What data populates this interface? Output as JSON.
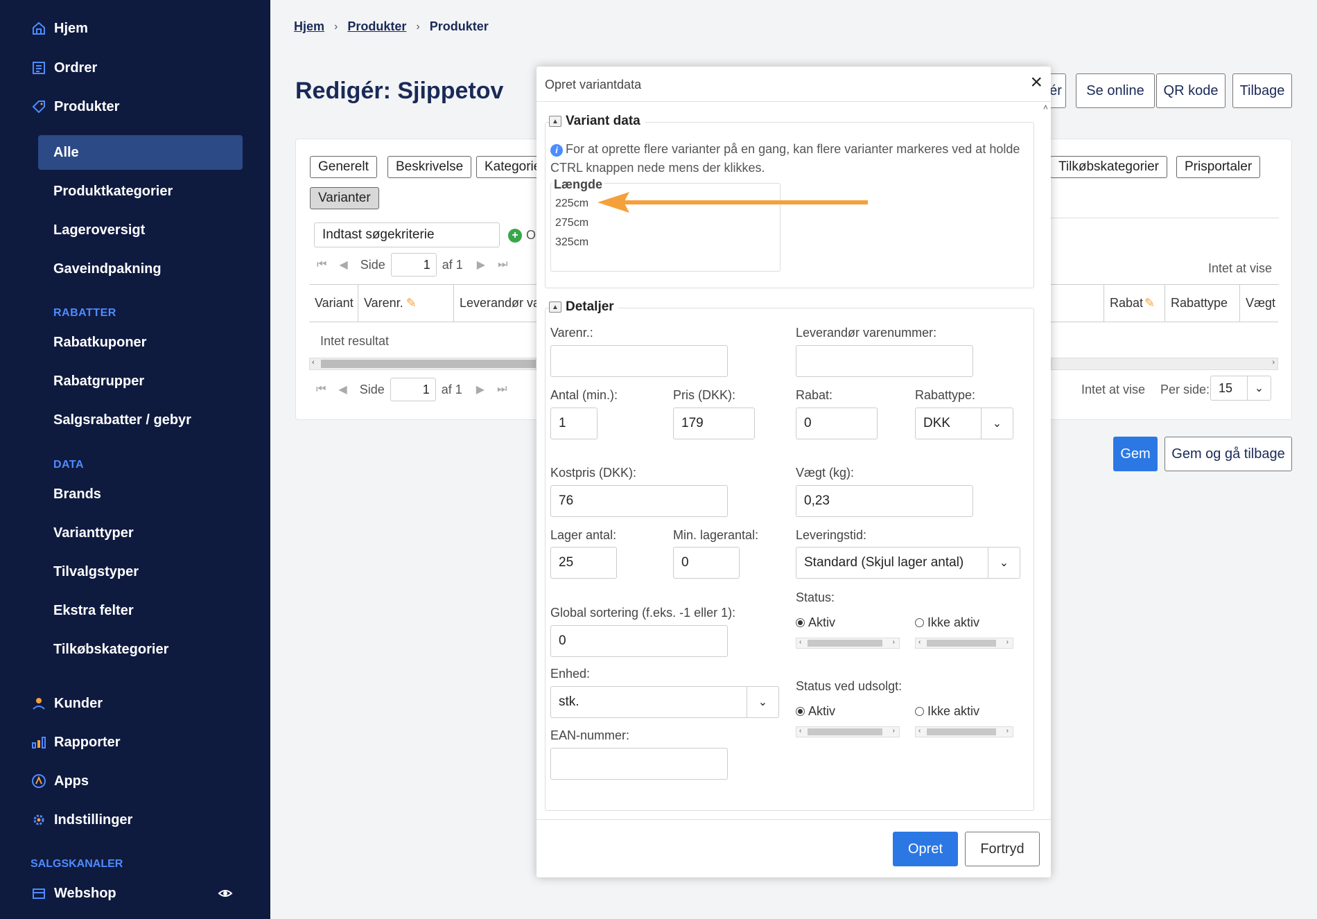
{
  "sidebar": {
    "items": [
      {
        "label": "Hjem",
        "icon": "home-icon"
      },
      {
        "label": "Ordrer",
        "icon": "orders-icon"
      },
      {
        "label": "Produkter",
        "icon": "tag-icon"
      }
    ],
    "sub_items": [
      "Alle",
      "Produktkategorier",
      "Lageroversigt",
      "Gaveindpakning"
    ],
    "rabatter_head": "RABATTER",
    "rabatter_items": [
      "Rabatkuponer",
      "Rabatgrupper",
      "Salgsrabatter / gebyr"
    ],
    "data_head": "DATA",
    "data_items": [
      "Brands",
      "Varianttyper",
      "Tilvalgstyper",
      "Ekstra felter",
      "Tilkøbskategorier"
    ],
    "bottom_items": [
      {
        "label": "Kunder",
        "icon": "user-icon"
      },
      {
        "label": "Rapporter",
        "icon": "bar-chart-icon"
      },
      {
        "label": "Apps",
        "icon": "apps-icon"
      },
      {
        "label": "Indstillinger",
        "icon": "gear-icon"
      }
    ],
    "salgskanaler_head": "SALGSKANALER",
    "webshop": "Webshop",
    "accent": "#4d8cff",
    "background": "#0f1a3f"
  },
  "breadcrumb": {
    "items": [
      "Hjem",
      "Produkter"
    ],
    "current": "Produkter"
  },
  "page": {
    "title": "Redigér: Sjippetov",
    "top_buttons": [
      "ér",
      "Se online",
      "QR kode",
      "Tilbage"
    ],
    "tabs": [
      "Generelt",
      "Beskrivelse",
      "Kategorie",
      "Tilkøbskategorier",
      "Prisportaler",
      "Varianter"
    ],
    "search_placeholder": "Indtast søgekriterie",
    "add_label": "O",
    "pager": {
      "side": "Side",
      "page": "1",
      "of": "af 1"
    },
    "nothing_to_show": "Intet at vise",
    "per_side": "Per side:",
    "per_side_value": "15",
    "columns_left": [
      "Variant",
      "Varenr.",
      "Leverandør va"
    ],
    "columns_right": [
      "Rabat",
      "Rabattype",
      "Vægt"
    ],
    "no_result": "Intet resultat",
    "save": "Gem",
    "save_back": "Gem og gå tilbage"
  },
  "modal": {
    "title": "Opret variantdata",
    "variant_data": {
      "legend": "Variant data",
      "info": "For at oprette flere varianter på en gang, kan flere varianter markeres ved at holde CTRL knappen nede mens der klikkes.",
      "list_title": "Længde",
      "options": [
        "225cm",
        "275cm",
        "325cm"
      ]
    },
    "details": {
      "legend": "Detaljer",
      "varenr_label": "Varenr.:",
      "varenr_value": "",
      "lev_label": "Leverandør varenummer:",
      "lev_value": "",
      "antal_label": "Antal (min.):",
      "antal_value": "1",
      "pris_label": "Pris (DKK):",
      "pris_value": "179",
      "rabat_label": "Rabat:",
      "rabat_value": "0",
      "rabattype_label": "Rabattype:",
      "rabattype_value": "DKK",
      "kostpris_label": "Kostpris (DKK):",
      "kostpris_value": "76",
      "vaegt_label": "Vægt (kg):",
      "vaegt_value": "0,23",
      "lager_label": "Lager antal:",
      "lager_value": "25",
      "minlager_label": "Min. lagerantal:",
      "minlager_value": "0",
      "levtid_label": "Leveringstid:",
      "levtid_value": "Standard (Skjul lager antal)",
      "sort_label": "Global sortering (f.eks. -1 eller 1):",
      "sort_value": "0",
      "status_label": "Status:",
      "status_on": "Aktiv",
      "status_off": "Ikke aktiv",
      "enhed_label": "Enhed:",
      "enhed_value": "stk.",
      "udsolgt_label": "Status ved udsolgt:",
      "udsolgt_on": "Aktiv",
      "udsolgt_off": "Ikke aktiv",
      "ean_label": "EAN-nummer:",
      "ean_value": ""
    },
    "create": "Opret",
    "cancel": "Fortryd"
  },
  "colors": {
    "primary": "#2b78e4",
    "annotation_arrow": "#f5a03a",
    "title": "#1a2a57"
  }
}
